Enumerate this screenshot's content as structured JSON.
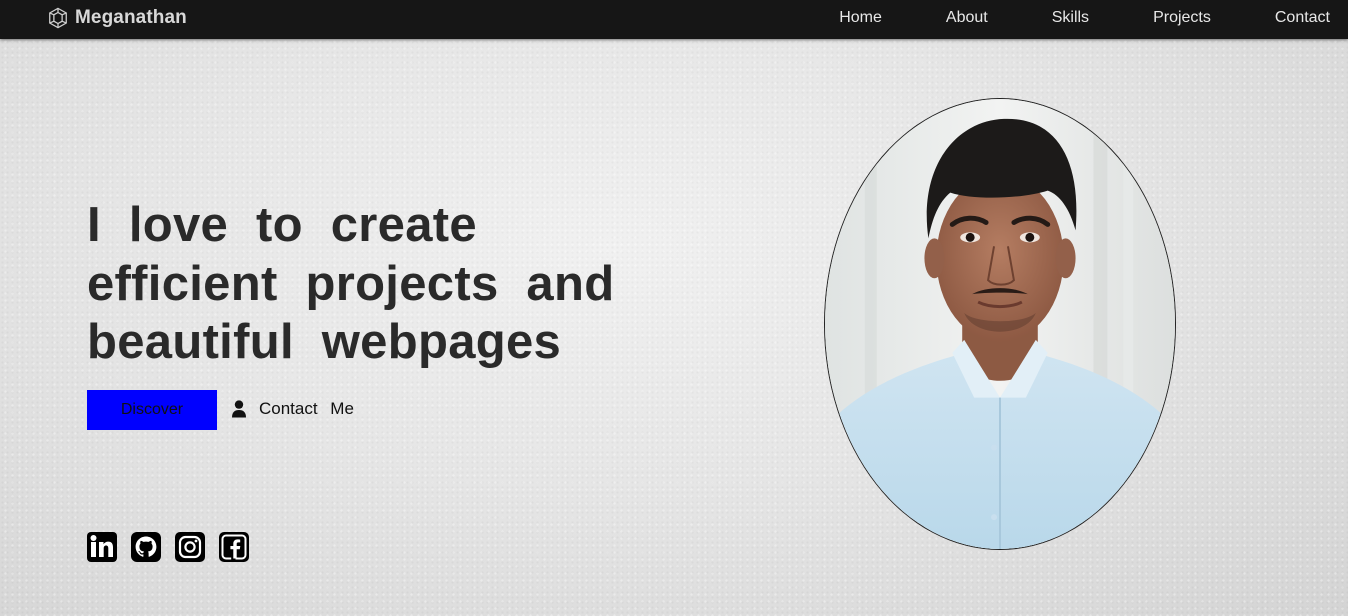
{
  "navbar": {
    "brand": {
      "icon": "hexagon-logo-icon",
      "name": "Meganathan"
    },
    "links": [
      {
        "label": "Home"
      },
      {
        "label": "About"
      },
      {
        "label": "Skills"
      },
      {
        "label": "Projects"
      },
      {
        "label": "Contact"
      }
    ]
  },
  "hero": {
    "title_lines": [
      "I love to create",
      "efficient projects and",
      "beautiful webpages"
    ],
    "discover_label": "Discover",
    "contact_me_icon": "user-icon",
    "contact_me_label": "Contact Me"
  },
  "socials": [
    {
      "icon": "linkedin-icon"
    },
    {
      "icon": "github-icon"
    },
    {
      "icon": "instagram-icon"
    },
    {
      "icon": "facebook-icon"
    }
  ],
  "portrait": {
    "subject": "profile-photo"
  },
  "colors": {
    "navbar_bg": "#161616",
    "button_bg": "#0000ff",
    "title_text": "#2a2a2a"
  }
}
